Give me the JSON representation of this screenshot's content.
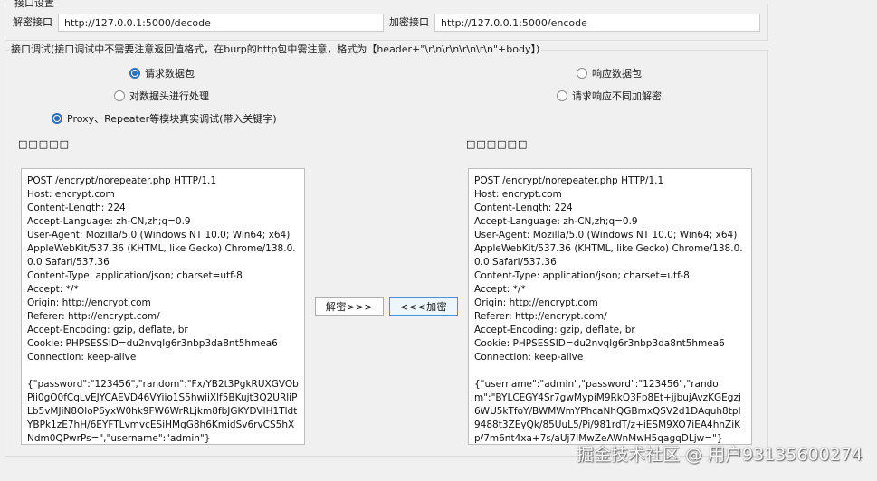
{
  "settings": {
    "group_title": "接口设置",
    "decode_label": "解密接口",
    "decode_value": "http://127.0.0.1:5000/decode",
    "encode_label": "加密接口",
    "encode_value": "http://127.0.0.1:5000/encode"
  },
  "debug": {
    "group_title": "接口调试(接口调试中不需要注意返回值格式，在burp的http包中需注意，格式为【header+\"\\r\\n\\r\\n\\r\\n\\r\\n\"+body】)",
    "radios": {
      "request_packet": "请求数据包",
      "response_packet": "响应数据包",
      "process_header": "对数据头进行处理",
      "no_decrypt_response": "请求响应不同加解密",
      "proxy_repeater": "Proxy、Repeater等模块真实调试(带入关键字)"
    },
    "left_title": "□□□□□",
    "right_title": "□□□□□□",
    "decrypt_button": "解密>>>",
    "encrypt_button": "<<<加密",
    "left_text": "POST /encrypt/norepeater.php HTTP/1.1\nHost: encrypt.com\nContent-Length: 224\nAccept-Language: zh-CN,zh;q=0.9\nUser-Agent: Mozilla/5.0 (Windows NT 10.0; Win64; x64) AppleWebKit/537.36 (KHTML, like Gecko) Chrome/138.0.0.0 Safari/537.36\nContent-Type: application/json; charset=utf-8\nAccept: */*\nOrigin: http://encrypt.com\nReferer: http://encrypt.com/\nAccept-Encoding: gzip, deflate, br\nCookie: PHPSESSID=du2nvqlg6r3nbp3da8nt5hmea6\nConnection: keep-alive\n\n{\"password\":\"123456\",\"random\":\"Fx/YB2t3PgkRUXGVObPii0gO0fCqLvEJYCAEVD46VYiio1S5hwiiXlf5BKujt3Q2URliPLb5vMJiN8OloP6yxW0hk9FW6WrRLjkm8fbJGKYDVIH1TldtYBPk1zE7hH/6EYFTLvmvcESiHMgG8h6KmidSv6rvCS5hXNdm0QPwrPs=\",\"username\":\"admin\"}",
    "right_text": "POST /encrypt/norepeater.php HTTP/1.1\nHost: encrypt.com\nContent-Length: 224\nAccept-Language: zh-CN,zh;q=0.9\nUser-Agent: Mozilla/5.0 (Windows NT 10.0; Win64; x64) AppleWebKit/537.36 (KHTML, like Gecko) Chrome/138.0.0.0 Safari/537.36\nContent-Type: application/json; charset=utf-8\nAccept: */*\nOrigin: http://encrypt.com\nReferer: http://encrypt.com/\nAccept-Encoding: gzip, deflate, br\nCookie: PHPSESSID=du2nvqlg6r3nbp3da8nt5hmea6\nConnection: keep-alive\n\n{\"username\":\"admin\",\"password\":\"123456\",\"random\":\"BYLCEGY4Sr7gwMypiM9RkQ3Fp8Et+jjbujAvzKGEgzj6WU5kTfoY/BWMWmYPhcaNhQGBmxQSV2d1DAquh8tpI9488t3ZEyQk/85UuL5/Pi/981rdT/z+iESM9XO7iEA4hnZiKp/7m6nt4xa+7s/aUj7IMwZeAWnMwH5qagqDLjw=\"}"
  },
  "watermark": "掘金技术社区 @ 用户9313560027​4"
}
